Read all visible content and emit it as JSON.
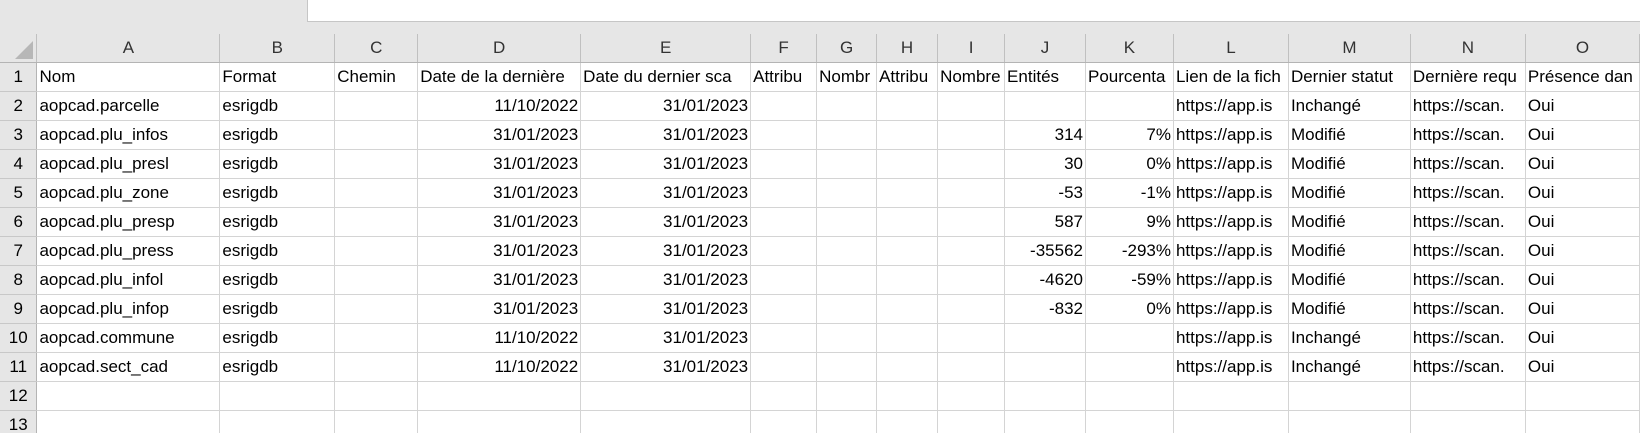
{
  "columns": [
    "A",
    "B",
    "C",
    "D",
    "E",
    "F",
    "G",
    "H",
    "I",
    "J",
    "K",
    "L",
    "M",
    "N",
    "O"
  ],
  "rows": [
    {
      "n": "1",
      "cells": [
        "Nom",
        "Format",
        "Chemin",
        "Date de la dernière",
        "Date du dernier sca",
        "Attribu",
        "Nombr",
        "Attribu",
        "Nombre",
        "Entités",
        "Pourcenta",
        "Lien de la fich",
        "Dernier statut",
        "Dernière requ",
        "Présence dan"
      ]
    },
    {
      "n": "2",
      "cells": [
        "aopcad.parcelle",
        "esrigdb",
        "",
        "11/10/2022",
        "31/01/2023",
        "",
        "",
        "",
        "",
        "",
        "",
        "https://app.is",
        "Inchangé",
        "https://scan.",
        "Oui"
      ]
    },
    {
      "n": "3",
      "cells": [
        "aopcad.plu_infos",
        "esrigdb",
        "",
        "31/01/2023",
        "31/01/2023",
        "",
        "",
        "",
        "",
        "314",
        "7%",
        "https://app.is",
        "Modifié",
        "https://scan.",
        "Oui"
      ]
    },
    {
      "n": "4",
      "cells": [
        "aopcad.plu_presl",
        "esrigdb",
        "",
        "31/01/2023",
        "31/01/2023",
        "",
        "",
        "",
        "",
        "30",
        "0%",
        "https://app.is",
        "Modifié",
        "https://scan.",
        "Oui"
      ]
    },
    {
      "n": "5",
      "cells": [
        "aopcad.plu_zone",
        "esrigdb",
        "",
        "31/01/2023",
        "31/01/2023",
        "",
        "",
        "",
        "",
        "-53",
        "-1%",
        "https://app.is",
        "Modifié",
        "https://scan.",
        "Oui"
      ]
    },
    {
      "n": "6",
      "cells": [
        "aopcad.plu_presp",
        "esrigdb",
        "",
        "31/01/2023",
        "31/01/2023",
        "",
        "",
        "",
        "",
        "587",
        "9%",
        "https://app.is",
        "Modifié",
        "https://scan.",
        "Oui"
      ]
    },
    {
      "n": "7",
      "cells": [
        "aopcad.plu_press",
        "esrigdb",
        "",
        "31/01/2023",
        "31/01/2023",
        "",
        "",
        "",
        "",
        "-35562",
        "-293%",
        "https://app.is",
        "Modifié",
        "https://scan.",
        "Oui"
      ]
    },
    {
      "n": "8",
      "cells": [
        "aopcad.plu_infol",
        "esrigdb",
        "",
        "31/01/2023",
        "31/01/2023",
        "",
        "",
        "",
        "",
        "-4620",
        "-59%",
        "https://app.is",
        "Modifié",
        "https://scan.",
        "Oui"
      ]
    },
    {
      "n": "9",
      "cells": [
        "aopcad.plu_infop",
        "esrigdb",
        "",
        "31/01/2023",
        "31/01/2023",
        "",
        "",
        "",
        "",
        "-832",
        "0%",
        "https://app.is",
        "Modifié",
        "https://scan.",
        "Oui"
      ]
    },
    {
      "n": "10",
      "cells": [
        "aopcad.commune",
        "esrigdb",
        "",
        "11/10/2022",
        "31/01/2023",
        "",
        "",
        "",
        "",
        "",
        "",
        "https://app.is",
        "Inchangé",
        "https://scan.",
        "Oui"
      ]
    },
    {
      "n": "11",
      "cells": [
        "aopcad.sect_cad",
        "esrigdb",
        "",
        "11/10/2022",
        "31/01/2023",
        "",
        "",
        "",
        "",
        "",
        "",
        "https://app.is",
        "Inchangé",
        "https://scan.",
        "Oui"
      ]
    },
    {
      "n": "12",
      "cells": [
        "",
        "",
        "",
        "",
        "",
        "",
        "",
        "",
        "",
        "",
        "",
        "",
        "",
        "",
        ""
      ]
    },
    {
      "n": "13",
      "cells": [
        "",
        "",
        "",
        "",
        "",
        "",
        "",
        "",
        "",
        "",
        "",
        "",
        "",
        "",
        ""
      ]
    }
  ]
}
